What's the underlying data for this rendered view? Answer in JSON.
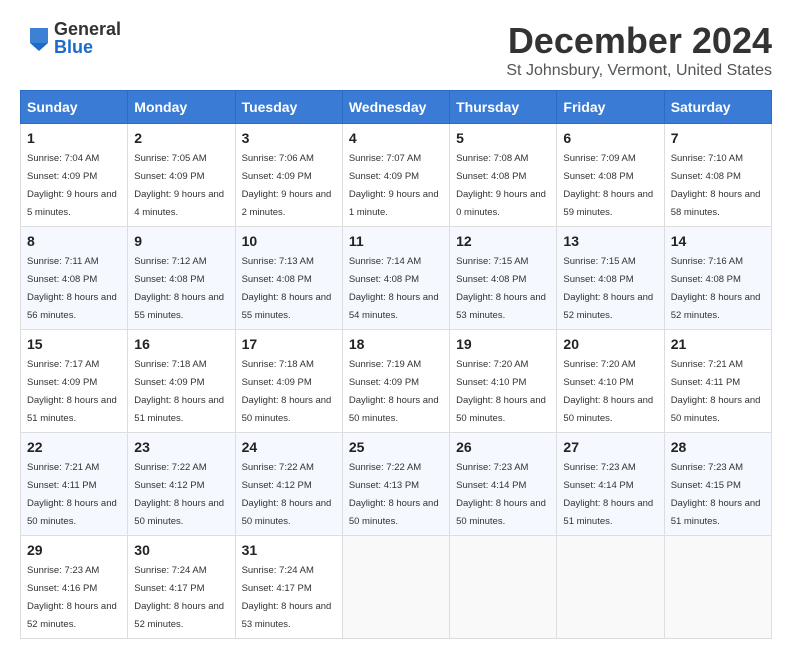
{
  "logo": {
    "general": "General",
    "blue": "Blue"
  },
  "title": "December 2024",
  "subtitle": "St Johnsbury, Vermont, United States",
  "days_of_week": [
    "Sunday",
    "Monday",
    "Tuesday",
    "Wednesday",
    "Thursday",
    "Friday",
    "Saturday"
  ],
  "weeks": [
    [
      {
        "day": "1",
        "sunrise": "7:04 AM",
        "sunset": "4:09 PM",
        "daylight": "9 hours and 5 minutes."
      },
      {
        "day": "2",
        "sunrise": "7:05 AM",
        "sunset": "4:09 PM",
        "daylight": "9 hours and 4 minutes."
      },
      {
        "day": "3",
        "sunrise": "7:06 AM",
        "sunset": "4:09 PM",
        "daylight": "9 hours and 2 minutes."
      },
      {
        "day": "4",
        "sunrise": "7:07 AM",
        "sunset": "4:09 PM",
        "daylight": "9 hours and 1 minute."
      },
      {
        "day": "5",
        "sunrise": "7:08 AM",
        "sunset": "4:08 PM",
        "daylight": "9 hours and 0 minutes."
      },
      {
        "day": "6",
        "sunrise": "7:09 AM",
        "sunset": "4:08 PM",
        "daylight": "8 hours and 59 minutes."
      },
      {
        "day": "7",
        "sunrise": "7:10 AM",
        "sunset": "4:08 PM",
        "daylight": "8 hours and 58 minutes."
      }
    ],
    [
      {
        "day": "8",
        "sunrise": "7:11 AM",
        "sunset": "4:08 PM",
        "daylight": "8 hours and 56 minutes."
      },
      {
        "day": "9",
        "sunrise": "7:12 AM",
        "sunset": "4:08 PM",
        "daylight": "8 hours and 55 minutes."
      },
      {
        "day": "10",
        "sunrise": "7:13 AM",
        "sunset": "4:08 PM",
        "daylight": "8 hours and 55 minutes."
      },
      {
        "day": "11",
        "sunrise": "7:14 AM",
        "sunset": "4:08 PM",
        "daylight": "8 hours and 54 minutes."
      },
      {
        "day": "12",
        "sunrise": "7:15 AM",
        "sunset": "4:08 PM",
        "daylight": "8 hours and 53 minutes."
      },
      {
        "day": "13",
        "sunrise": "7:15 AM",
        "sunset": "4:08 PM",
        "daylight": "8 hours and 52 minutes."
      },
      {
        "day": "14",
        "sunrise": "7:16 AM",
        "sunset": "4:08 PM",
        "daylight": "8 hours and 52 minutes."
      }
    ],
    [
      {
        "day": "15",
        "sunrise": "7:17 AM",
        "sunset": "4:09 PM",
        "daylight": "8 hours and 51 minutes."
      },
      {
        "day": "16",
        "sunrise": "7:18 AM",
        "sunset": "4:09 PM",
        "daylight": "8 hours and 51 minutes."
      },
      {
        "day": "17",
        "sunrise": "7:18 AM",
        "sunset": "4:09 PM",
        "daylight": "8 hours and 50 minutes."
      },
      {
        "day": "18",
        "sunrise": "7:19 AM",
        "sunset": "4:09 PM",
        "daylight": "8 hours and 50 minutes."
      },
      {
        "day": "19",
        "sunrise": "7:20 AM",
        "sunset": "4:10 PM",
        "daylight": "8 hours and 50 minutes."
      },
      {
        "day": "20",
        "sunrise": "7:20 AM",
        "sunset": "4:10 PM",
        "daylight": "8 hours and 50 minutes."
      },
      {
        "day": "21",
        "sunrise": "7:21 AM",
        "sunset": "4:11 PM",
        "daylight": "8 hours and 50 minutes."
      }
    ],
    [
      {
        "day": "22",
        "sunrise": "7:21 AM",
        "sunset": "4:11 PM",
        "daylight": "8 hours and 50 minutes."
      },
      {
        "day": "23",
        "sunrise": "7:22 AM",
        "sunset": "4:12 PM",
        "daylight": "8 hours and 50 minutes."
      },
      {
        "day": "24",
        "sunrise": "7:22 AM",
        "sunset": "4:12 PM",
        "daylight": "8 hours and 50 minutes."
      },
      {
        "day": "25",
        "sunrise": "7:22 AM",
        "sunset": "4:13 PM",
        "daylight": "8 hours and 50 minutes."
      },
      {
        "day": "26",
        "sunrise": "7:23 AM",
        "sunset": "4:14 PM",
        "daylight": "8 hours and 50 minutes."
      },
      {
        "day": "27",
        "sunrise": "7:23 AM",
        "sunset": "4:14 PM",
        "daylight": "8 hours and 51 minutes."
      },
      {
        "day": "28",
        "sunrise": "7:23 AM",
        "sunset": "4:15 PM",
        "daylight": "8 hours and 51 minutes."
      }
    ],
    [
      {
        "day": "29",
        "sunrise": "7:23 AM",
        "sunset": "4:16 PM",
        "daylight": "8 hours and 52 minutes."
      },
      {
        "day": "30",
        "sunrise": "7:24 AM",
        "sunset": "4:17 PM",
        "daylight": "8 hours and 52 minutes."
      },
      {
        "day": "31",
        "sunrise": "7:24 AM",
        "sunset": "4:17 PM",
        "daylight": "8 hours and 53 minutes."
      },
      null,
      null,
      null,
      null
    ]
  ]
}
